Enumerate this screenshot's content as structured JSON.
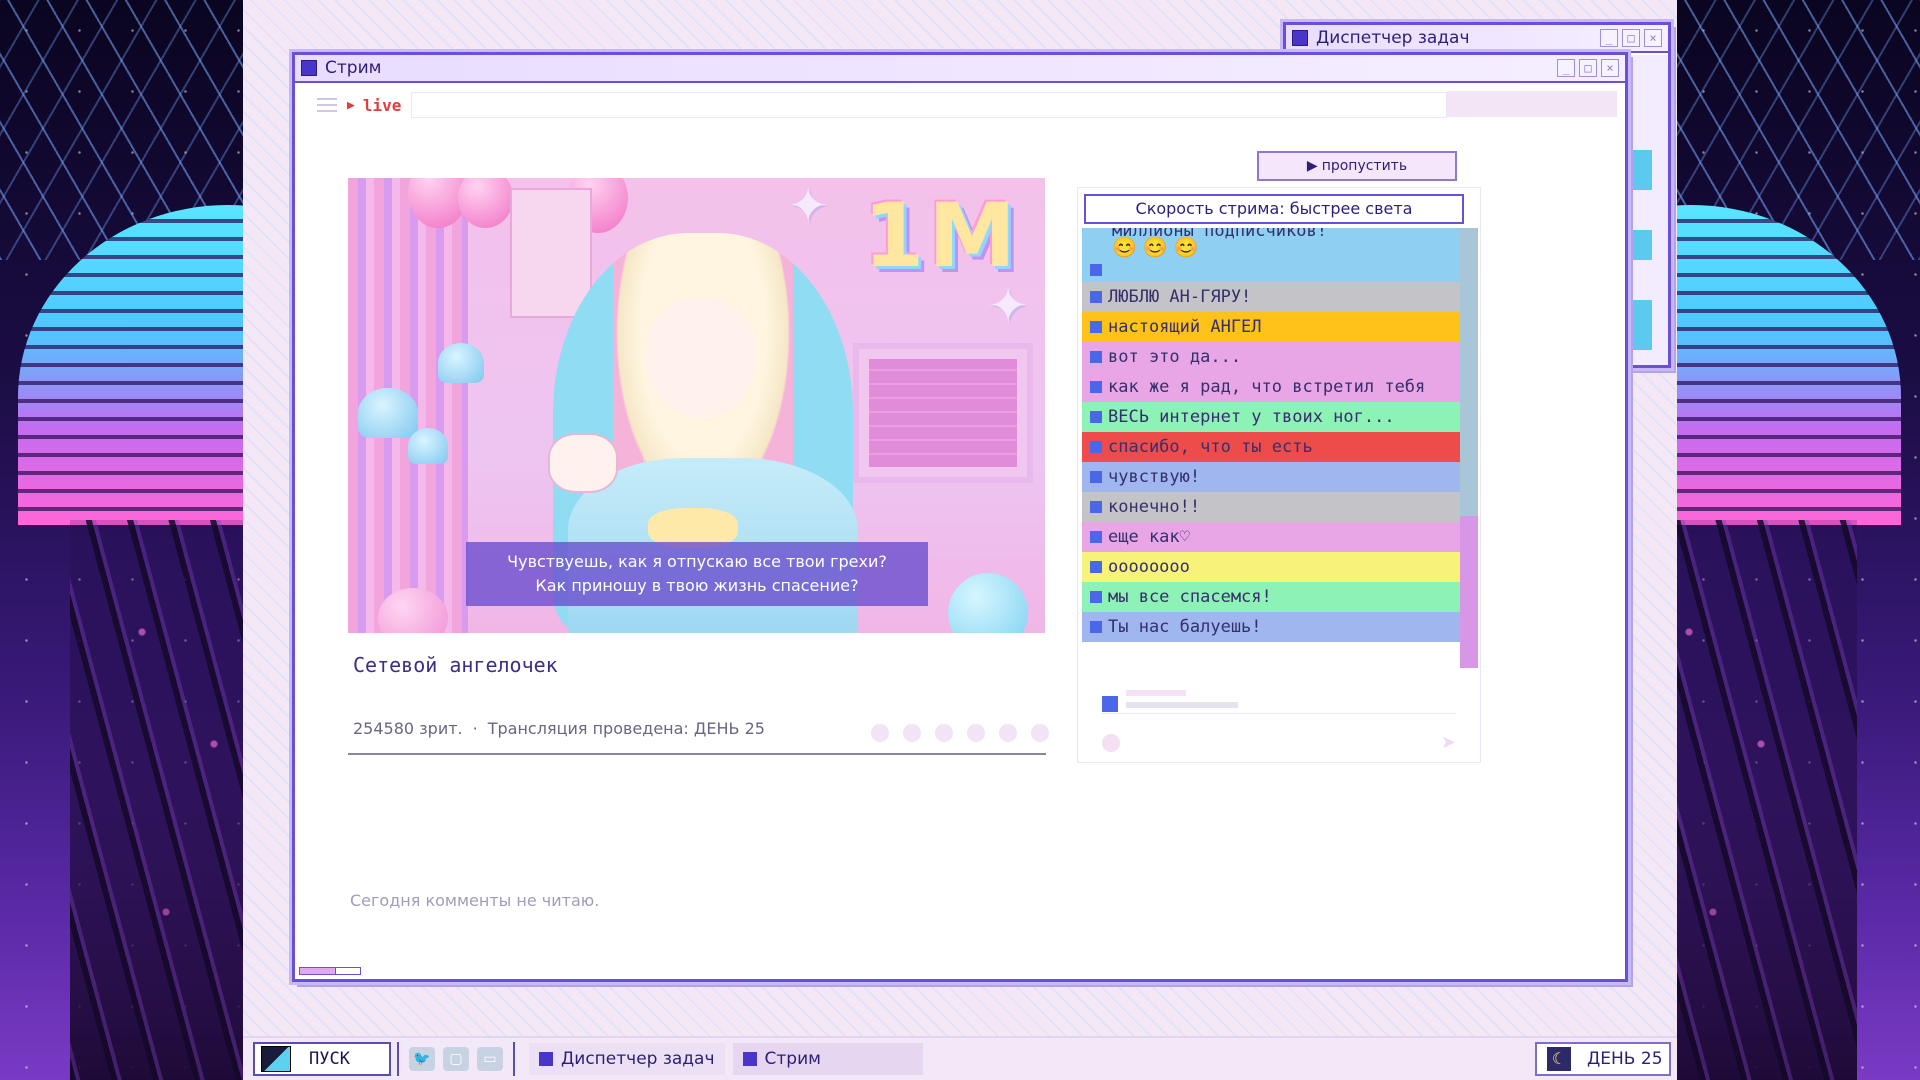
{
  "taskmgr_window": {
    "title": "Диспетчер задач"
  },
  "stream_window": {
    "title": "Стрим",
    "live_label": "live",
    "skip_button": "пропустить",
    "video": {
      "overlay_text": "1M",
      "subtitle_line1": "Чувствуешь, как я отпускаю все твои грехи?",
      "subtitle_line2": "Как приношу в твою жизнь спасение?"
    },
    "stream_title": "Сетевой ангелочек",
    "viewers": "254580 зрит.",
    "separator": "·",
    "broadcast_info": "Трансляция проведена: ДЕНЬ 25",
    "comments_note": "Сегодня комменты не читаю.",
    "chat": {
      "header": "Скорость стрима: быстрее света",
      "messages": [
        {
          "text": "миллионы подписчиков!",
          "emoji": "😊😊😊",
          "color": "#8fd0f2"
        },
        {
          "text": "ЛЮБЛЮ АН-ГЯРУ!",
          "color": "#c4c4c8"
        },
        {
          "text": "настоящий АНГЕЛ",
          "color": "#ffc21a"
        },
        {
          "text": "вот это да...",
          "color": "#e8a6e6"
        },
        {
          "text": "как же я рад, что встретил тебя",
          "color": "#e8a6e6"
        },
        {
          "text": "ВЕСЬ интернет у твоих ног...",
          "color": "#8cf2b6"
        },
        {
          "text": "спасибо, что ты есть",
          "color": "#ee4b4b"
        },
        {
          "text": "чувствую!",
          "color": "#9fb6ee"
        },
        {
          "text": "конечно!!",
          "color": "#c4c4c8"
        },
        {
          "text": "еще как♡",
          "color": "#e8a6e6"
        },
        {
          "text": "oooooooo",
          "color": "#f6f27a"
        },
        {
          "text": "мы все спасемся!",
          "color": "#8cf2b6"
        },
        {
          "text": "Ты нас балуешь!",
          "color": "#9fb6ee"
        }
      ]
    }
  },
  "taskbar": {
    "start_label": "ПУСК",
    "items": [
      {
        "label": "Диспетчер задач"
      },
      {
        "label": "Стрим"
      }
    ],
    "day_label": "ДЕНЬ 25"
  },
  "colors": {
    "accent": "#6a4fd8",
    "live": "#e23d3d",
    "chat_square": "#4a67e8"
  }
}
